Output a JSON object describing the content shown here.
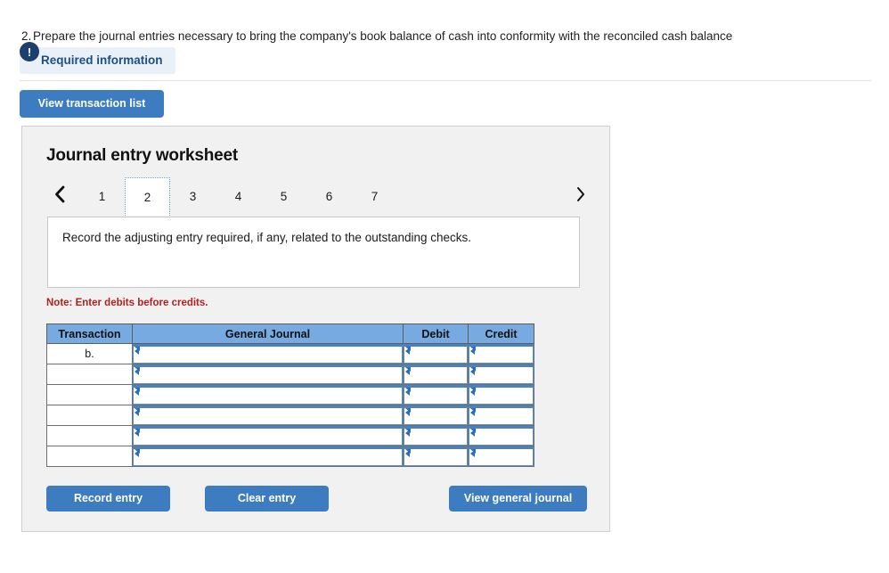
{
  "requirement_line": {
    "bullet": "2.",
    "text": "Prepare the journal entries necessary to bring the company's book balance of cash into conformity with the reconciled cash balance"
  },
  "required_info": {
    "icon": "exclamation-icon",
    "glyph": "!",
    "label": "Required information"
  },
  "toolbar": {
    "view_transaction_list_label": "View transaction list"
  },
  "worksheet": {
    "title": "Journal entry worksheet",
    "prev_icon": "chevron-left-icon",
    "prev_glyph": "‹",
    "next_icon": "chevron-right-icon",
    "next_glyph": "›",
    "tabs": [
      {
        "label": "1",
        "active": false
      },
      {
        "label": "2",
        "active": true
      },
      {
        "label": "3",
        "active": false
      },
      {
        "label": "4",
        "active": false
      },
      {
        "label": "5",
        "active": false
      },
      {
        "label": "6",
        "active": false
      },
      {
        "label": "7",
        "active": false
      }
    ],
    "prompt": "Record the adjusting entry required, if any, related to the outstanding checks.",
    "note": "Note: Enter debits before credits.",
    "table": {
      "headers": [
        "Transaction",
        "General Journal",
        "Debit",
        "Credit"
      ],
      "rows": [
        {
          "transaction": "b.",
          "general_journal": "",
          "debit": "",
          "credit": ""
        },
        {
          "transaction": "",
          "general_journal": "",
          "debit": "",
          "credit": ""
        },
        {
          "transaction": "",
          "general_journal": "",
          "debit": "",
          "credit": ""
        },
        {
          "transaction": "",
          "general_journal": "",
          "debit": "",
          "credit": ""
        },
        {
          "transaction": "",
          "general_journal": "",
          "debit": "",
          "credit": ""
        },
        {
          "transaction": "",
          "general_journal": "",
          "debit": "",
          "credit": ""
        }
      ]
    },
    "actions": {
      "record_entry_label": "Record entry",
      "clear_entry_label": "Clear entry",
      "view_general_journal_label": "View general journal"
    }
  },
  "colors": {
    "accent_blue": "#3d7cc0",
    "header_blue": "#76aae0",
    "badge_navy": "#1c3f6e",
    "note_red": "#b42020",
    "panel_gray": "#f1f1f1"
  }
}
